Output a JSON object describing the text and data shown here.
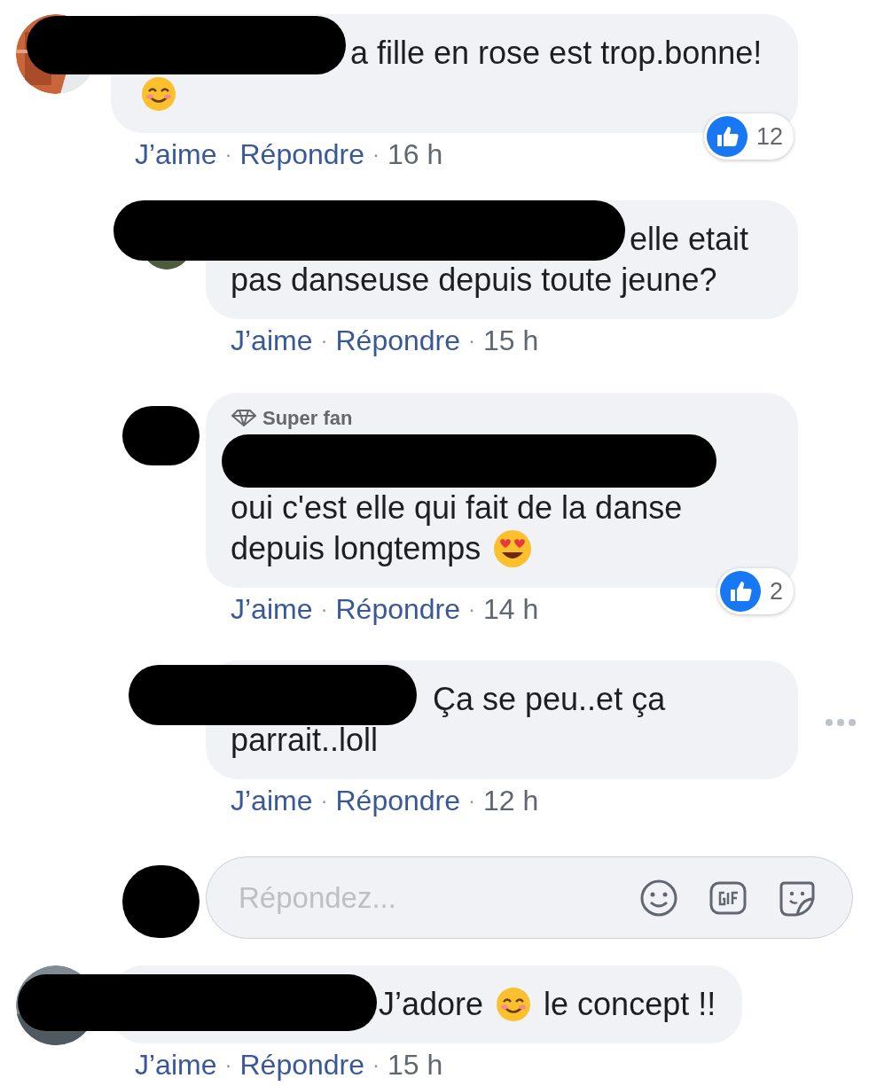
{
  "comments": [
    {
      "kind": "comment",
      "avatar": {
        "kind": "picture"
      },
      "lines": [
        [
          {
            "kind": "text",
            "text": "a fille en rose est trop.bonne!"
          }
        ],
        [
          {
            "kind": "smile"
          }
        ]
      ],
      "reactions": {
        "count": "12"
      },
      "more_menu": false,
      "actions": [
        "J’aime",
        "·",
        "Répondre",
        "·"
      ],
      "time": "16 h"
    },
    {
      "kind": "reply",
      "avatar": {
        "kind": "picture"
      },
      "lines": [
        [
          {
            "kind": "text",
            "text": "elle etait"
          }
        ],
        [
          {
            "kind": "text",
            "text": "pas danseuse depuis toute jeune?"
          }
        ]
      ],
      "more_menu": false,
      "actions": [
        "J’aime",
        "·",
        "Répondre",
        "·"
      ],
      "time": "15 h"
    },
    {
      "kind": "reply",
      "badge": "Super fan",
      "lines": [
        [
          {
            "kind": "text",
            "text": "oui c'est elle qui fait de la danse"
          }
        ],
        [
          {
            "kind": "text",
            "text": "depuis longtemps"
          },
          {
            "kind": "heart_eyes"
          }
        ]
      ],
      "reactions": {
        "count": "2"
      },
      "more_menu": false,
      "actions": [
        "J’aime",
        "·",
        "Répondre",
        "·"
      ],
      "time": "14 h"
    },
    {
      "kind": "reply",
      "lines": [
        [
          {
            "kind": "text",
            "text": "Ça se peu..et ça"
          }
        ],
        [
          {
            "kind": "text",
            "text": "parrait..loll"
          }
        ]
      ],
      "more_menu": true,
      "actions": [
        "J’aime",
        "·",
        "Répondre",
        "·"
      ],
      "time": "12 h"
    },
    {
      "kind": "reply_box",
      "placeholder": "Répondez..."
    },
    {
      "kind": "comment",
      "avatar": {
        "kind": "picture"
      },
      "lines": [
        [
          {
            "kind": "text",
            "text": "J’adore"
          },
          {
            "kind": "smile"
          },
          {
            "kind": "text",
            "text": "le concept !!"
          }
        ]
      ],
      "more_menu": false,
      "actions": [
        "J’aime",
        "·",
        "Répondre",
        "·"
      ],
      "time": "15 h"
    }
  ]
}
